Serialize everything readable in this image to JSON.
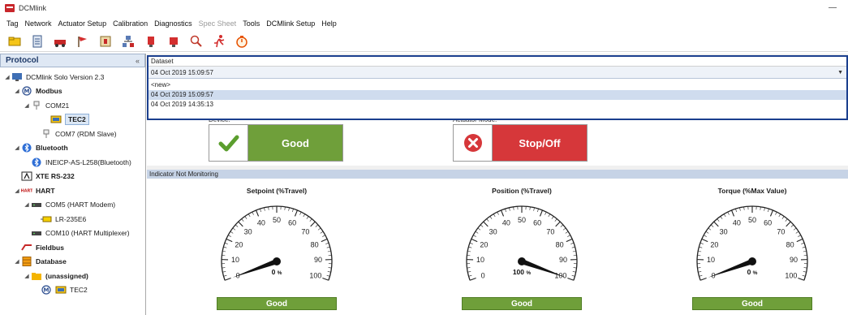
{
  "app": {
    "title": "DCMlink"
  },
  "menu": [
    "Tag",
    "Network",
    "Actuator Setup",
    "Calibration",
    "Diagnostics",
    "Spec Sheet",
    "Tools",
    "DCMlink Setup",
    "Help"
  ],
  "menu_disabled": [
    "Spec Sheet"
  ],
  "toolbar": [
    "folder-icon",
    "document-icon",
    "vehicle-icon",
    "flag-icon",
    "device-icon",
    "network-icon",
    "valve-red-icon",
    "valve-red2-icon",
    "search-icon",
    "run-icon",
    "timer-icon"
  ],
  "protocol_panel": {
    "title": "Protocol",
    "collapse": "«",
    "tree": [
      {
        "label": "DCMlink Solo Version 2.3",
        "indent": 0,
        "arrow": "◢",
        "icon": "computer"
      },
      {
        "label": "Modbus",
        "indent": 1,
        "arrow": "◢",
        "icon": "modbus",
        "bold": true
      },
      {
        "label": "COM21",
        "indent": 2,
        "arrow": "◢",
        "icon": "port"
      },
      {
        "label": "TEC2",
        "indent": 4,
        "arrow": "",
        "icon": "tec",
        "bold": true,
        "selected": true
      },
      {
        "label": "COM7 (RDM Slave)",
        "indent": 3,
        "arrow": "",
        "icon": "port"
      },
      {
        "label": "Bluetooth",
        "indent": 1,
        "arrow": "◢",
        "icon": "bluetooth",
        "bold": true
      },
      {
        "label": "INEICP-AS-L258(Bluetooth)",
        "indent": 2,
        "arrow": "",
        "icon": "bluetooth"
      },
      {
        "label": "XTE RS-232",
        "indent": 1,
        "arrow": "",
        "icon": "xte",
        "bold": true
      },
      {
        "label": "HART",
        "indent": 1,
        "arrow": "◢",
        "icon": "hart",
        "bold": true
      },
      {
        "label": "COM5 (HART Modem)",
        "indent": 2,
        "arrow": "◢",
        "icon": "modem"
      },
      {
        "label": "LR-235E6",
        "indent": 3,
        "arrow": "",
        "icon": "device"
      },
      {
        "label": "COM10 (HART Multiplexer)",
        "indent": 2,
        "arrow": "",
        "icon": "modem"
      },
      {
        "label": "Fieldbus",
        "indent": 1,
        "arrow": "",
        "icon": "fieldbus",
        "bold": true
      },
      {
        "label": "Database",
        "indent": 1,
        "arrow": "◢",
        "icon": "database",
        "bold": true
      },
      {
        "label": "(unassigned)",
        "indent": 2,
        "arrow": "◢",
        "icon": "folder",
        "bold": true
      },
      {
        "label": "TEC2",
        "indent": 3,
        "arrow": "",
        "icon": "modbus-tec"
      }
    ]
  },
  "dataset": {
    "label": "Dataset",
    "selected": "04 Oct 2019 15:09:57",
    "options": [
      "<new>",
      "04 Oct 2019 15:09:57",
      "04 Oct 2019 14:35:13"
    ],
    "highlighted": "04 Oct 2019 15:09:57"
  },
  "status": {
    "device_label": "Device:",
    "device_value": "Good",
    "device_color": "#6f9f3a",
    "actuator_mode_label": "Actuator Mode:",
    "actuator_mode_value": "Stop/Off",
    "actuator_mode_color": "#d6373a"
  },
  "indicator": {
    "text": "Indicator Not Monitoring"
  },
  "gauges": [
    {
      "title": "Setpoint (%Travel)",
      "value": 0,
      "value_text": "0",
      "unit": "%",
      "status": "Good"
    },
    {
      "title": "Position (%Travel)",
      "value": 100,
      "value_text": "100",
      "unit": "%",
      "status": "Good"
    },
    {
      "title": "Torque (%Max Value)",
      "value": 0,
      "value_text": "0",
      "unit": "%",
      "status": "Good"
    }
  ],
  "gauge_scale": [
    "0",
    "10",
    "20",
    "30",
    "40",
    "50",
    "60",
    "70",
    "80",
    "90",
    "100"
  ],
  "colors": {
    "good": "#6f9f3a",
    "stop": "#d6373a",
    "accent": "#1b3f8e"
  }
}
